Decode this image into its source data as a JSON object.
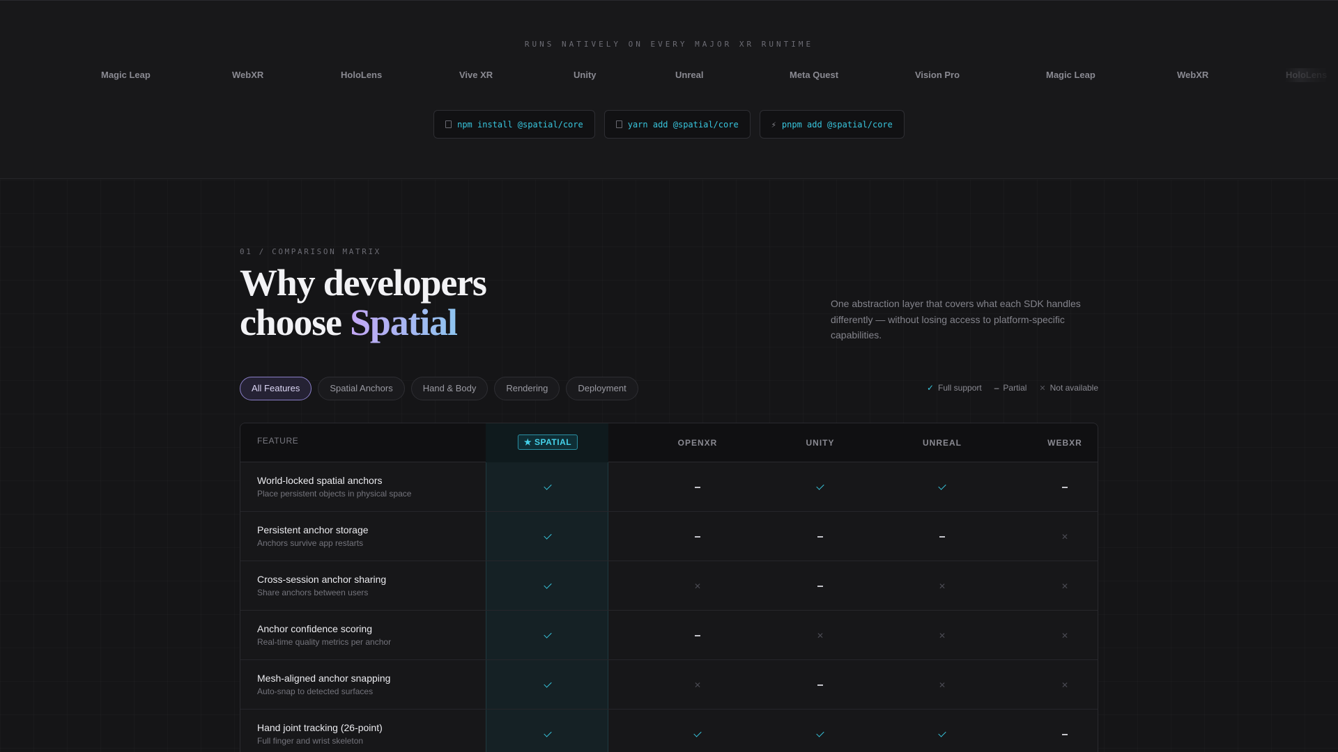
{
  "runtimes": {
    "kicker": "RUNS NATIVELY ON EVERY MAJOR XR RUNTIME",
    "logos": [
      "Magic Leap",
      "WebXR",
      "HoloLens",
      "Vive XR",
      "Unity",
      "Unreal",
      "Meta Quest",
      "Vision Pro",
      "Magic Leap",
      "WebXR",
      "HoloLens"
    ]
  },
  "install": [
    {
      "icon": "copy-icon",
      "command": "npm install @spatial/core"
    },
    {
      "icon": "copy-icon",
      "command": "yarn add @spatial/core"
    },
    {
      "icon": "bolt-icon",
      "command": "pnpm add @spatial/core"
    }
  ],
  "section": {
    "kicker": "01 / COMPARISON MATRIX",
    "title_line1": "Why developers",
    "title_line2_plain": "choose ",
    "title_line2_accent": "Spatial",
    "lede": "One abstraction layer that covers what each SDK handles differently — without losing access to platform-specific capabilities."
  },
  "filters": [
    "All Features",
    "Spatial Anchors",
    "Hand & Body",
    "Rendering",
    "Deployment"
  ],
  "active_filter": "All Features",
  "legend": {
    "full": "Full support",
    "partial": "Partial",
    "none": "Not available"
  },
  "table": {
    "feature_header": "FEATURE",
    "spatial_header": "★ SPATIAL",
    "columns": [
      "OPENXR",
      "UNITY",
      "UNREAL",
      "WEBXR"
    ],
    "rows": [
      {
        "title": "World-locked spatial anchors",
        "subtitle": "Place persistent objects in physical space",
        "values": [
          "full",
          "partial",
          "full",
          "full",
          "partial"
        ]
      },
      {
        "title": "Persistent anchor storage",
        "subtitle": "Anchors survive app restarts",
        "values": [
          "full",
          "partial",
          "partial",
          "partial",
          "none"
        ]
      },
      {
        "title": "Cross-session anchor sharing",
        "subtitle": "Share anchors between users",
        "values": [
          "full",
          "none",
          "partial",
          "none",
          "none"
        ]
      },
      {
        "title": "Anchor confidence scoring",
        "subtitle": "Real-time quality metrics per anchor",
        "values": [
          "full",
          "partial",
          "none",
          "none",
          "none"
        ]
      },
      {
        "title": "Mesh-aligned anchor snapping",
        "subtitle": "Auto-snap to detected surfaces",
        "values": [
          "full",
          "none",
          "partial",
          "none",
          "none"
        ]
      },
      {
        "title": "Hand joint tracking (26-point)",
        "subtitle": "Full finger and wrist skeleton",
        "values": [
          "full",
          "full",
          "full",
          "full",
          "partial"
        ]
      }
    ]
  },
  "colors": {
    "accent_cyan": "#38c6de",
    "accent_violet": "#c4a7f5",
    "background": "#151517"
  }
}
